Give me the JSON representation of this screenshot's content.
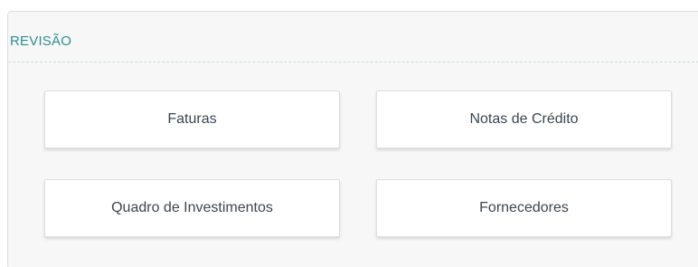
{
  "panel": {
    "title": "REVISÃO",
    "title_color": "#2f8f8b",
    "buttons": [
      {
        "label": "Faturas"
      },
      {
        "label": "Notas de Crédito"
      },
      {
        "label": "Quadro de Investimentos"
      },
      {
        "label": "Fornecedores"
      }
    ]
  }
}
